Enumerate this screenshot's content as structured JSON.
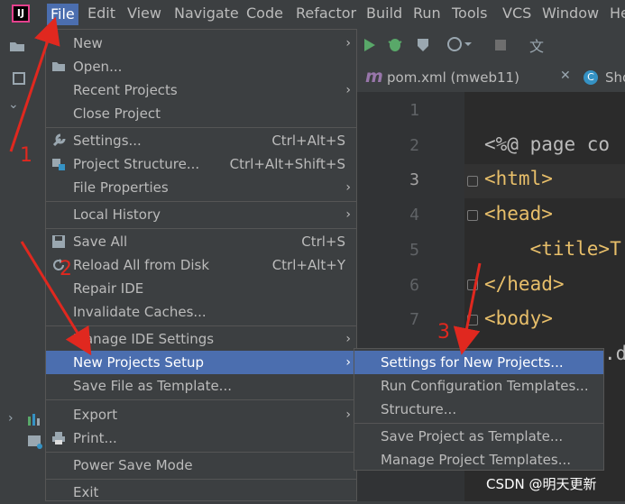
{
  "menubar": {
    "items": [
      "File",
      "Edit",
      "View",
      "Navigate",
      "Code",
      "Refactor",
      "Build",
      "Run",
      "Tools",
      "VCS",
      "Window",
      "He"
    ],
    "active": "File"
  },
  "editor": {
    "tab_label": "pom.xml (mweb11)",
    "tab2_label": "Sho",
    "line_numbers": [
      "1",
      "2",
      "3",
      "4",
      "5",
      "6",
      "7"
    ],
    "lines": [
      "",
      "<%@ page co",
      "<html>",
      "<head>",
      "    <title>T",
      "</head>",
      "<body>"
    ],
    "line8_partial": ".d"
  },
  "file_menu": {
    "items": [
      {
        "label": "New",
        "icon": "none",
        "has_submenu": true
      },
      {
        "label": "Open...",
        "icon": "folder-icon"
      },
      {
        "label": "Recent Projects",
        "has_submenu": true
      },
      {
        "label": "Close Project"
      },
      {
        "label": "Settings...",
        "shortcut": "Ctrl+Alt+S",
        "icon": "wrench-icon"
      },
      {
        "label": "Project Structure...",
        "shortcut": "Ctrl+Alt+Shift+S",
        "icon": "project-structure-icon"
      },
      {
        "label": "File Properties",
        "has_submenu": true
      },
      {
        "label": "Local History",
        "has_submenu": true
      },
      {
        "label": "Save All",
        "shortcut": "Ctrl+S",
        "icon": "save-icon"
      },
      {
        "label": "Reload All from Disk",
        "shortcut": "Ctrl+Alt+Y",
        "icon": "reload-icon"
      },
      {
        "label": "Repair IDE"
      },
      {
        "label": "Invalidate Caches..."
      },
      {
        "label": "Manage IDE Settings",
        "has_submenu": true
      },
      {
        "label": "New Projects Setup",
        "has_submenu": true,
        "selected": true
      },
      {
        "label": "Save File as Template..."
      },
      {
        "label": "Export",
        "has_submenu": true
      },
      {
        "label": "Print...",
        "icon": "printer-icon"
      },
      {
        "label": "Power Save Mode"
      },
      {
        "label": "Exit"
      }
    ]
  },
  "submenu": {
    "items": [
      {
        "label": "Settings for New Projects...",
        "selected": true
      },
      {
        "label": "Run Configuration Templates..."
      },
      {
        "label": "Structure..."
      },
      {
        "label": "Save Project as Template..."
      },
      {
        "label": "Manage Project Templates..."
      }
    ]
  },
  "annotations": {
    "one": "1",
    "two": "2",
    "three": "3"
  },
  "watermark": "CSDN @明天更新",
  "colors": {
    "selection": "#4b6eaf",
    "menu_bg": "#3c3f41",
    "editor_bg": "#2b2b2b",
    "tag": "#e8bf6a",
    "arrow": "#e0281f"
  }
}
